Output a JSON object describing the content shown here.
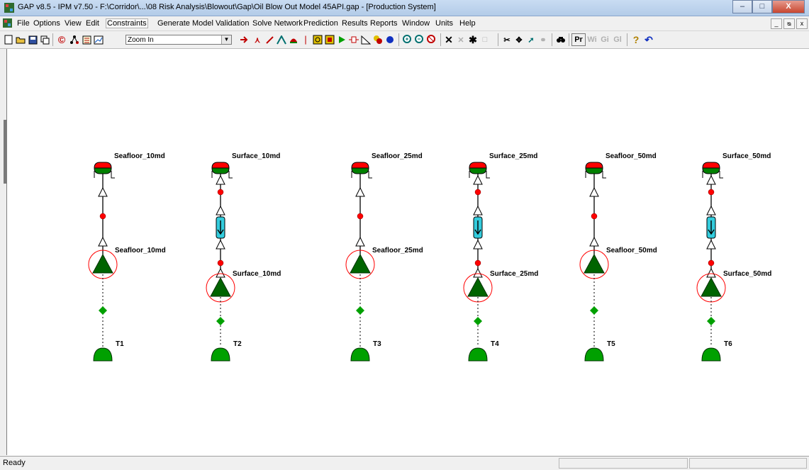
{
  "window": {
    "title": "GAP v8.5 - IPM v7.50 - F:\\Corridor\\...\\08 Risk Analysis\\Blowout\\Gap\\Oil Blow Out Model 45API.gap - [Production System]",
    "minimize": "–",
    "maximize": "□",
    "close": "X"
  },
  "menubar": {
    "items": [
      "File",
      "Options",
      "View",
      "Edit",
      "Constraints",
      "Generate",
      "Model Validation",
      "Solve Network",
      "Prediction",
      "Results",
      "Reports",
      "Window",
      "Units",
      "Help"
    ],
    "active": "Constraints",
    "mdi_buttons": [
      "_",
      "ᴓ",
      "x"
    ]
  },
  "toolbar": {
    "zoom_value": "Zoom In",
    "pr_label": "Pr",
    "wi_label": "Wi",
    "gi_label": "Gi",
    "gl_label": "Gl"
  },
  "network": {
    "systems": [
      {
        "separator": "Seafloor_10md",
        "well": "Seafloor_10md",
        "tank": "T1",
        "has_choke": false
      },
      {
        "separator": "Surface_10md",
        "well": "Surface_10md",
        "tank": "T2",
        "has_choke": true
      },
      {
        "separator": "Seafloor_25md",
        "well": "Seafloor_25md",
        "tank": "T3",
        "has_choke": false
      },
      {
        "separator": "Surface_25md",
        "well": "Surface_25md",
        "tank": "T4",
        "has_choke": true
      },
      {
        "separator": "Seafloor_50md",
        "well": "Seafloor_50md",
        "tank": "T5",
        "has_choke": false
      },
      {
        "separator": "Surface_50md",
        "well": "Surface_50md",
        "tank": "T6",
        "has_choke": true
      }
    ]
  },
  "status": {
    "text": "Ready"
  },
  "colors": {
    "separator_top": "#ff0000",
    "separator_bottom": "#008000",
    "well": "#006400",
    "tank": "#00a000",
    "junction": "#ff0000",
    "choke": "#33ccdd"
  }
}
